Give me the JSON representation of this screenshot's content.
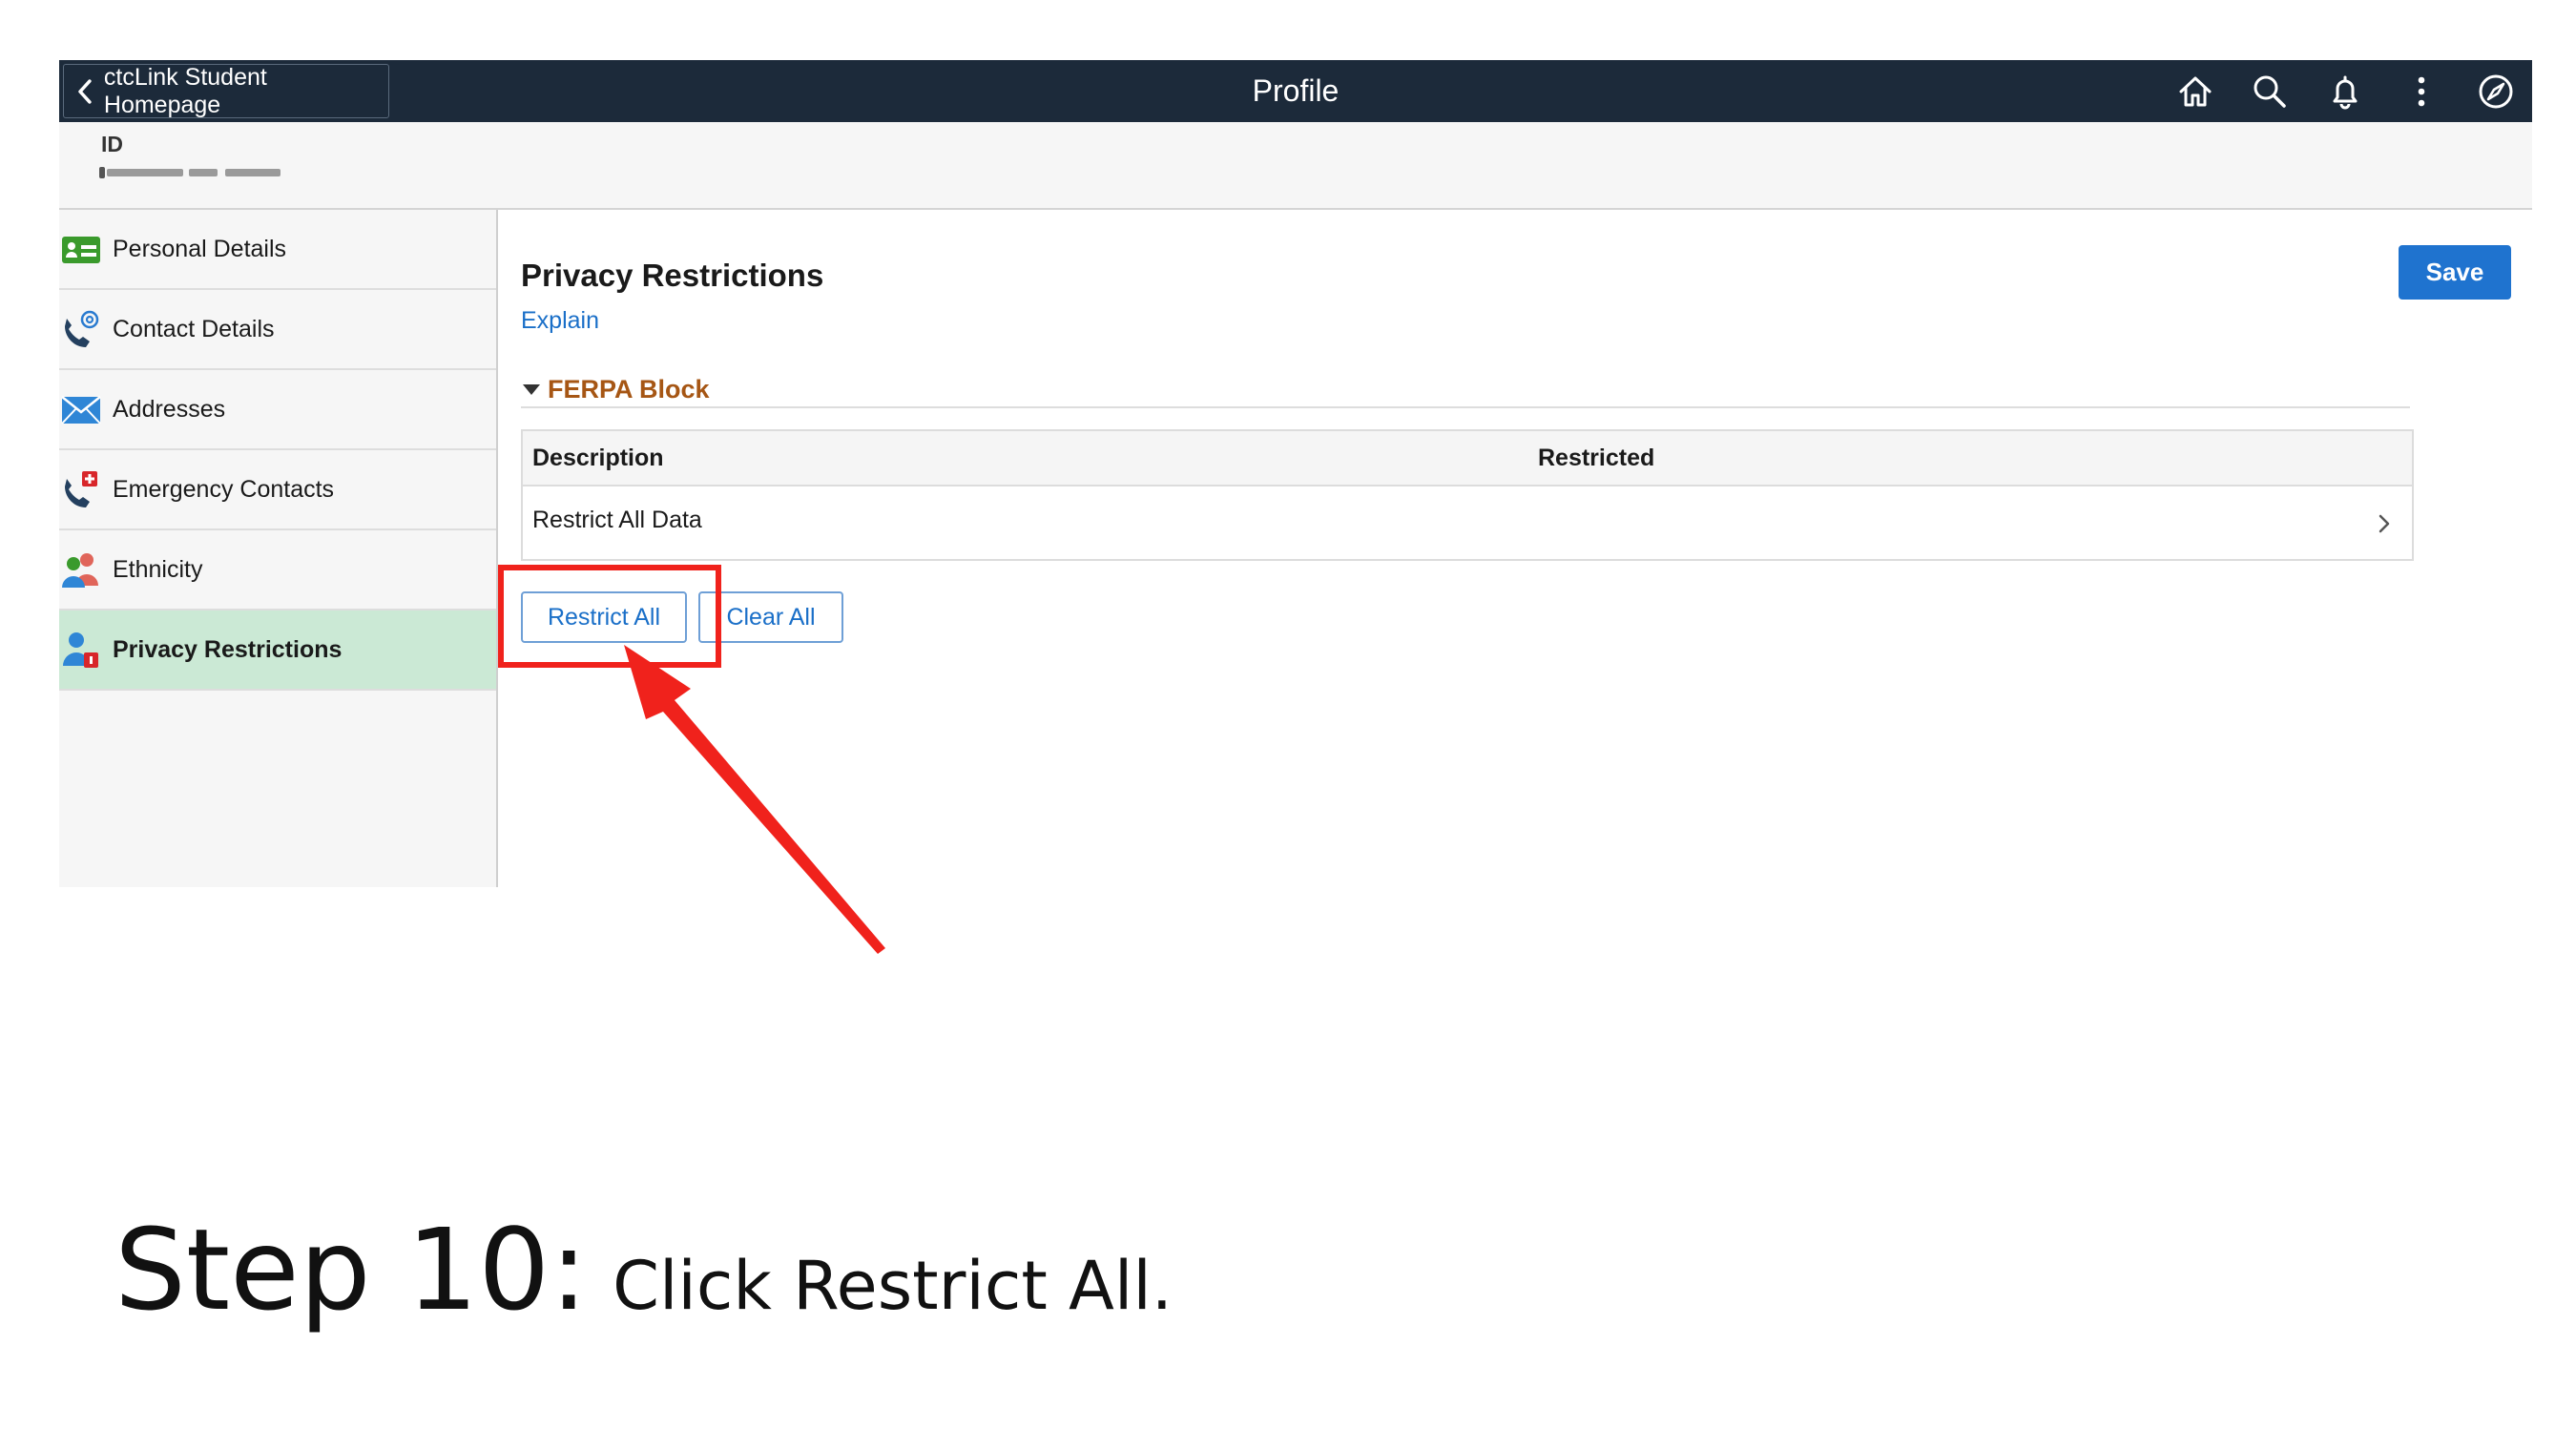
{
  "header": {
    "back_label": "ctcLink Student Homepage",
    "title": "Profile",
    "icons": [
      "home-icon",
      "search-icon",
      "bell-icon",
      "more-vertical-icon",
      "compass-icon"
    ]
  },
  "id_section": {
    "label": "ID"
  },
  "sidebar": {
    "items": [
      {
        "label": "Personal Details",
        "icon": "id-card-icon",
        "active": false
      },
      {
        "label": "Contact Details",
        "icon": "phone-at-icon",
        "active": false
      },
      {
        "label": "Addresses",
        "icon": "envelope-icon",
        "active": false
      },
      {
        "label": "Emergency Contacts",
        "icon": "phone-cross-icon",
        "active": false
      },
      {
        "label": "Ethnicity",
        "icon": "people-icon",
        "active": false
      },
      {
        "label": "Privacy Restrictions",
        "icon": "user-lock-icon",
        "active": true
      }
    ]
  },
  "main": {
    "section_title": "Privacy Restrictions",
    "explain_label": "Explain",
    "save_label": "Save",
    "group_title": "FERPA Block",
    "table": {
      "columns": [
        "Description",
        "Restricted"
      ],
      "rows": [
        {
          "description": "Restrict All Data",
          "restricted": ""
        }
      ]
    },
    "restrict_all_label": "Restrict All",
    "clear_all_label": "Clear All"
  },
  "caption": {
    "step": "Step 10:",
    "text": "Click Restrict All."
  },
  "colors": {
    "header_bg": "#1c2a3a",
    "accent_blue": "#1f73cf",
    "group_title": "#a65614",
    "active_nav": "#cbe9d5",
    "annotation_red": "#f0221c"
  }
}
